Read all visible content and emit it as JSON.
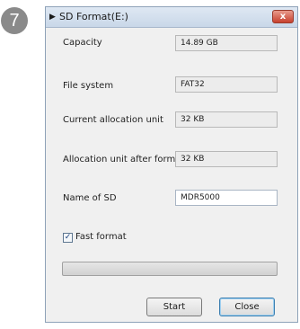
{
  "step_number": "7",
  "window": {
    "title": "SD Format(E:)",
    "title_icon": "play-triangle-icon",
    "close_glyph": "x"
  },
  "fields": {
    "capacity": {
      "label": "Capacity",
      "value": "14.89 GB"
    },
    "file_system": {
      "label": "File system",
      "value": "FAT32"
    },
    "current_unit": {
      "label": "Current allocation unit",
      "value": "32 KB"
    },
    "unit_after": {
      "label": "Allocation unit after format",
      "value": "32 KB"
    },
    "name_of_sd": {
      "label": "Name of SD",
      "value": "MDR5000"
    }
  },
  "fast_format": {
    "label": "Fast format",
    "checked": true
  },
  "progress": {
    "fraction": 0
  },
  "buttons": {
    "start": "Start",
    "close": "Close"
  },
  "colors": {
    "close_button": "#c7402d",
    "window_bg": "#f0f0f0",
    "titlebar": "#c9d7e8"
  }
}
